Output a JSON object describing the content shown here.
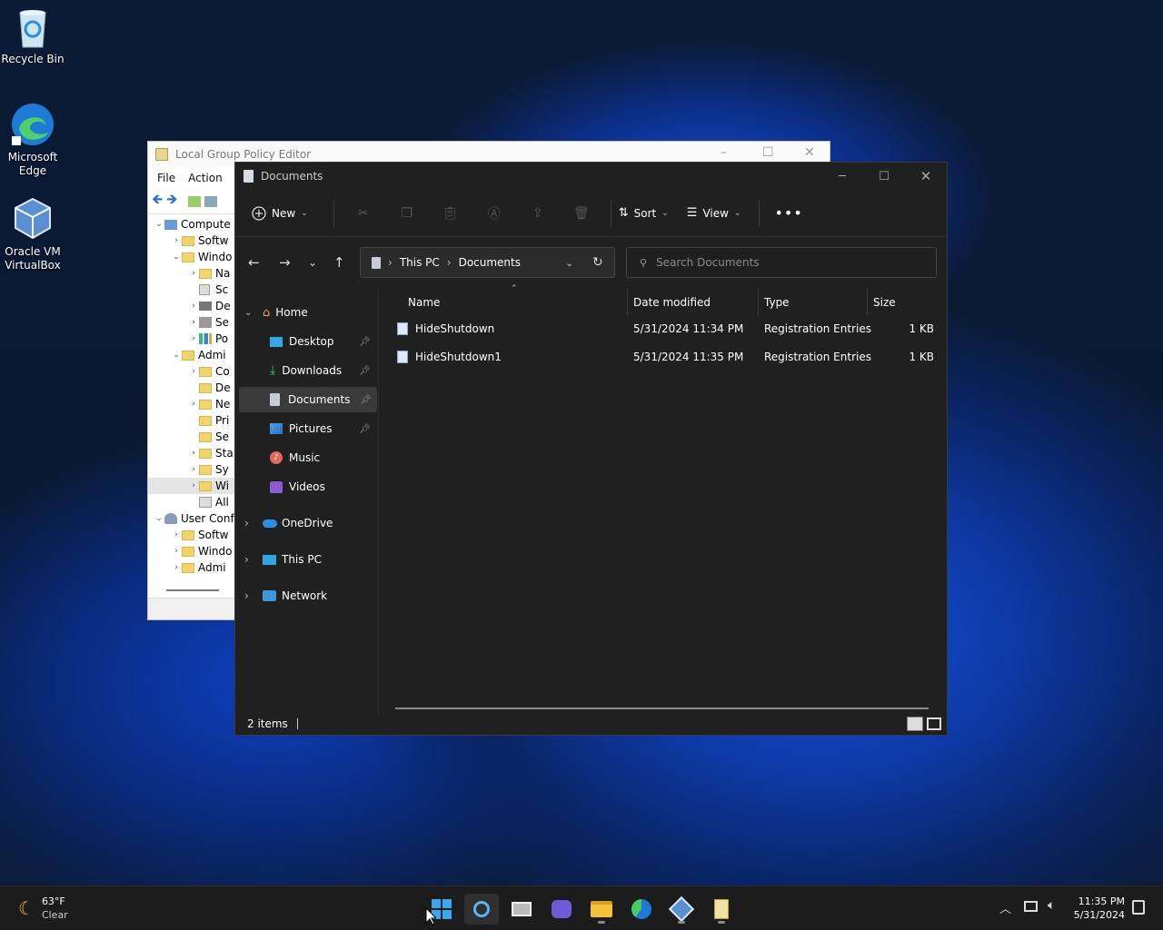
{
  "desktop": {
    "icons": [
      {
        "label": "Recycle Bin"
      },
      {
        "label": "Microsoft Edge"
      },
      {
        "label": "Oracle VM VirtualBox"
      }
    ]
  },
  "gpe": {
    "title": "Local Group Policy Editor",
    "menu": [
      "File",
      "Action"
    ],
    "tree": [
      "Compute",
      "Softw",
      "Windo",
      "Na",
      "Sc",
      "De",
      "Se",
      "Po",
      "Admi",
      "Co",
      "De",
      "Ne",
      "Pri",
      "Se",
      "Sta",
      "Sy",
      "Wi",
      "All",
      "User Conf",
      "Softw",
      "Windo",
      "Admi"
    ]
  },
  "explorer": {
    "title": "Documents",
    "cmd": {
      "new": "New",
      "sort": "Sort",
      "view": "View"
    },
    "address": {
      "root": "This PC",
      "current": "Documents"
    },
    "search": {
      "placeholder": "Search Documents"
    },
    "sidebar": [
      {
        "label": "Home"
      },
      {
        "label": "Desktop"
      },
      {
        "label": "Downloads"
      },
      {
        "label": "Documents"
      },
      {
        "label": "Pictures"
      },
      {
        "label": "Music"
      },
      {
        "label": "Videos"
      },
      {
        "label": "OneDrive"
      },
      {
        "label": "This PC"
      },
      {
        "label": "Network"
      }
    ],
    "columns": {
      "name": "Name",
      "date": "Date modified",
      "type": "Type",
      "size": "Size"
    },
    "files": [
      {
        "name": "HideShutdown",
        "date": "5/31/2024 11:34 PM",
        "type": "Registration Entries",
        "size": "1 KB"
      },
      {
        "name": "HideShutdown1",
        "date": "5/31/2024 11:35 PM",
        "type": "Registration Entries",
        "size": "1 KB"
      }
    ],
    "status": "2 items"
  },
  "taskbar": {
    "weather": {
      "temp": "63°F",
      "cond": "Clear"
    },
    "clock": {
      "time": "11:35 PM",
      "date": "5/31/2024"
    }
  }
}
